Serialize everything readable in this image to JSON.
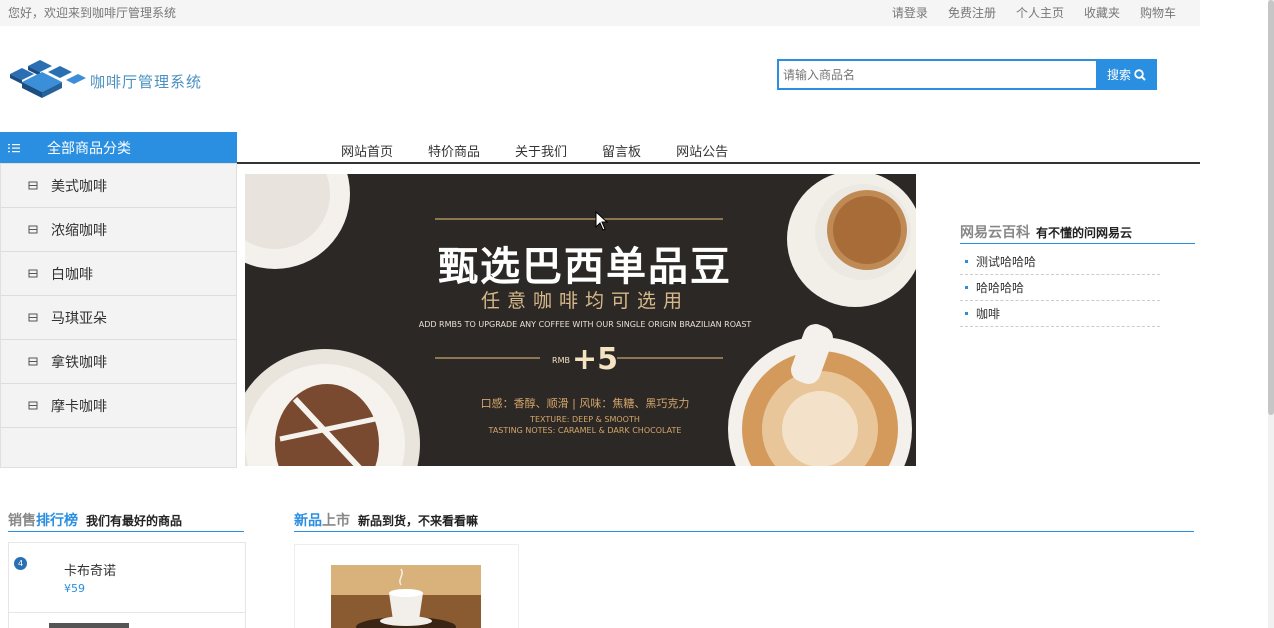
{
  "topbar": {
    "welcome": "您好，欢迎来到咖啡厅管理系统",
    "links": [
      "请登录",
      "免费注册",
      "个人主页",
      "收藏夹",
      "购物车"
    ]
  },
  "logo": {
    "text": "咖啡厅管理系统"
  },
  "search": {
    "placeholder": "请输入商品名",
    "button": "搜索"
  },
  "nav": {
    "all_categories": "全部商品分类",
    "menu": [
      "网站首页",
      "特价商品",
      "关于我们",
      "留言板",
      "网站公告"
    ]
  },
  "sidebar": {
    "items": [
      "美式咖啡",
      "浓缩咖啡",
      "白咖啡",
      "马琪亚朵",
      "拿铁咖啡",
      "摩卡咖啡"
    ]
  },
  "banner": {
    "title": "甄选巴西单品豆",
    "subtitle": "任意咖啡均可选用",
    "english": "ADD RMB5 TO UPGRADE ANY COFFEE WITH OUR SINGLE ORIGIN BRAZILIAN ROAST",
    "rmb_label": "RMB",
    "price": "+5",
    "taste": "口感：香醇、顺滑 | 风味：焦糖、黑巧克力",
    "notes_line1": "TEXTURE: DEEP & SMOOTH",
    "notes_line2": "TASTING NOTES: CARAMEL & DARK CHOCOLATE"
  },
  "wiki": {
    "title": "网易云百科",
    "subtitle": "有不懂的问网易云",
    "items": [
      "测试哈哈哈",
      "哈哈哈哈",
      "咖啡"
    ]
  },
  "rank": {
    "title_gray": "销售",
    "title_blue": "排行榜",
    "subtitle": "我们有最好的商品",
    "items": [
      {
        "num": "4",
        "name": "卡布奇诺",
        "price": "¥59"
      }
    ]
  },
  "newsec": {
    "title_blue": "新品",
    "title_gray": "上市",
    "subtitle": "新品到货，不来看看嘛"
  },
  "colors": {
    "accent": "#2a8fe0",
    "banner_bg": "#2c2826"
  }
}
